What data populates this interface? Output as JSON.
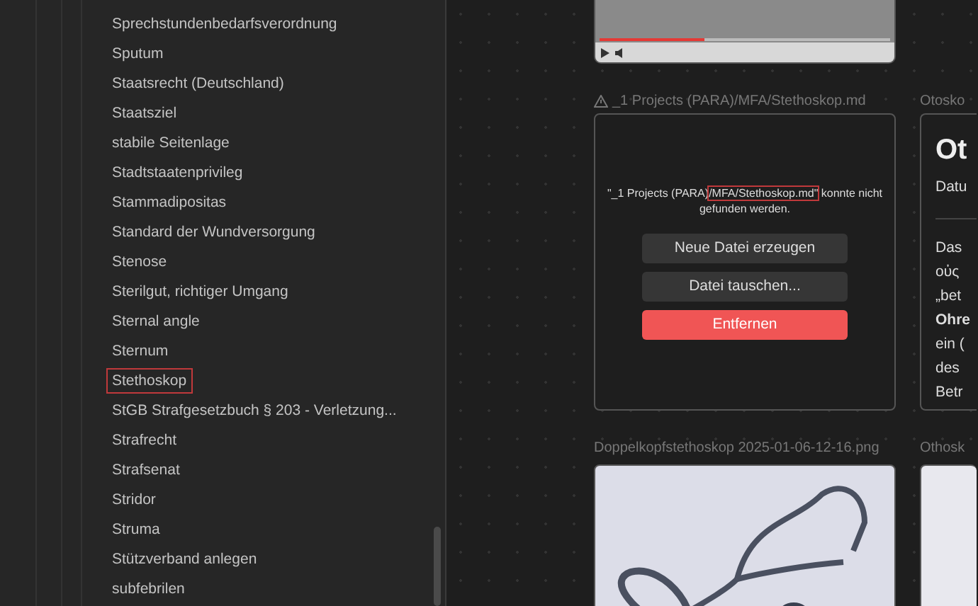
{
  "sidebar": {
    "items": [
      {
        "label": "Sprechstundenbedarfsverordnung",
        "highlighted": false
      },
      {
        "label": "Sputum",
        "highlighted": false
      },
      {
        "label": "Staatsrecht (Deutschland)",
        "highlighted": false
      },
      {
        "label": "Staatsziel",
        "highlighted": false
      },
      {
        "label": "stabile Seitenlage",
        "highlighted": false
      },
      {
        "label": "Stadtstaatenprivileg",
        "highlighted": false
      },
      {
        "label": "Stammadipositas",
        "highlighted": false
      },
      {
        "label": "Standard der Wundversorgung",
        "highlighted": false
      },
      {
        "label": "Stenose",
        "highlighted": false
      },
      {
        "label": "Sterilgut, richtiger Umgang",
        "highlighted": false
      },
      {
        "label": "Sternal angle",
        "highlighted": false
      },
      {
        "label": "Sternum",
        "highlighted": false
      },
      {
        "label": "Stethoskop",
        "highlighted": true
      },
      {
        "label": "StGB Strafgesetzbuch § 203 - Verletzung...",
        "highlighted": false
      },
      {
        "label": "Strafrecht",
        "highlighted": false
      },
      {
        "label": "Strafsenat",
        "highlighted": false
      },
      {
        "label": "Stridor",
        "highlighted": false
      },
      {
        "label": "Struma",
        "highlighted": false
      },
      {
        "label": "Stützverband anlegen",
        "highlighted": false
      },
      {
        "label": "subfebrilen",
        "highlighted": false
      }
    ]
  },
  "video": {
    "level": 0.36
  },
  "missing_file": {
    "title": "_1 Projects (PARA)/MFA/Stethoskop.md",
    "message": [
      {
        "text": "\"_1 Projects (PARA)",
        "highlighted": false
      },
      {
        "text": "/MFA/Stethoskop.md\"",
        "highlighted": true
      },
      {
        "text": " konnte nicht gefunden werden.",
        "highlighted": false
      }
    ],
    "buttons": [
      {
        "label": "Neue Datei erzeugen",
        "kind": "normal"
      },
      {
        "label": "Datei tauschen...",
        "kind": "normal"
      },
      {
        "label": "Entfernen",
        "kind": "danger"
      }
    ]
  },
  "image_card": {
    "title": "Doppelkopfstethoskop 2025-01-06-12-16.png"
  },
  "note_card": {
    "title": "Otosko",
    "heading": "Ot",
    "meta": "Datu",
    "lines": [
      {
        "text": "Das",
        "bold": false
      },
      {
        "text": "οὐς",
        "bold": false
      },
      {
        "text": "„bet",
        "bold": false
      },
      {
        "text": "Ohre",
        "bold": true
      },
      {
        "text": "ein (",
        "bold": false
      },
      {
        "text": "des",
        "bold": false
      },
      {
        "text": "Betr",
        "bold": false
      }
    ]
  },
  "bottom_right_card": {
    "title": "Othosk"
  }
}
